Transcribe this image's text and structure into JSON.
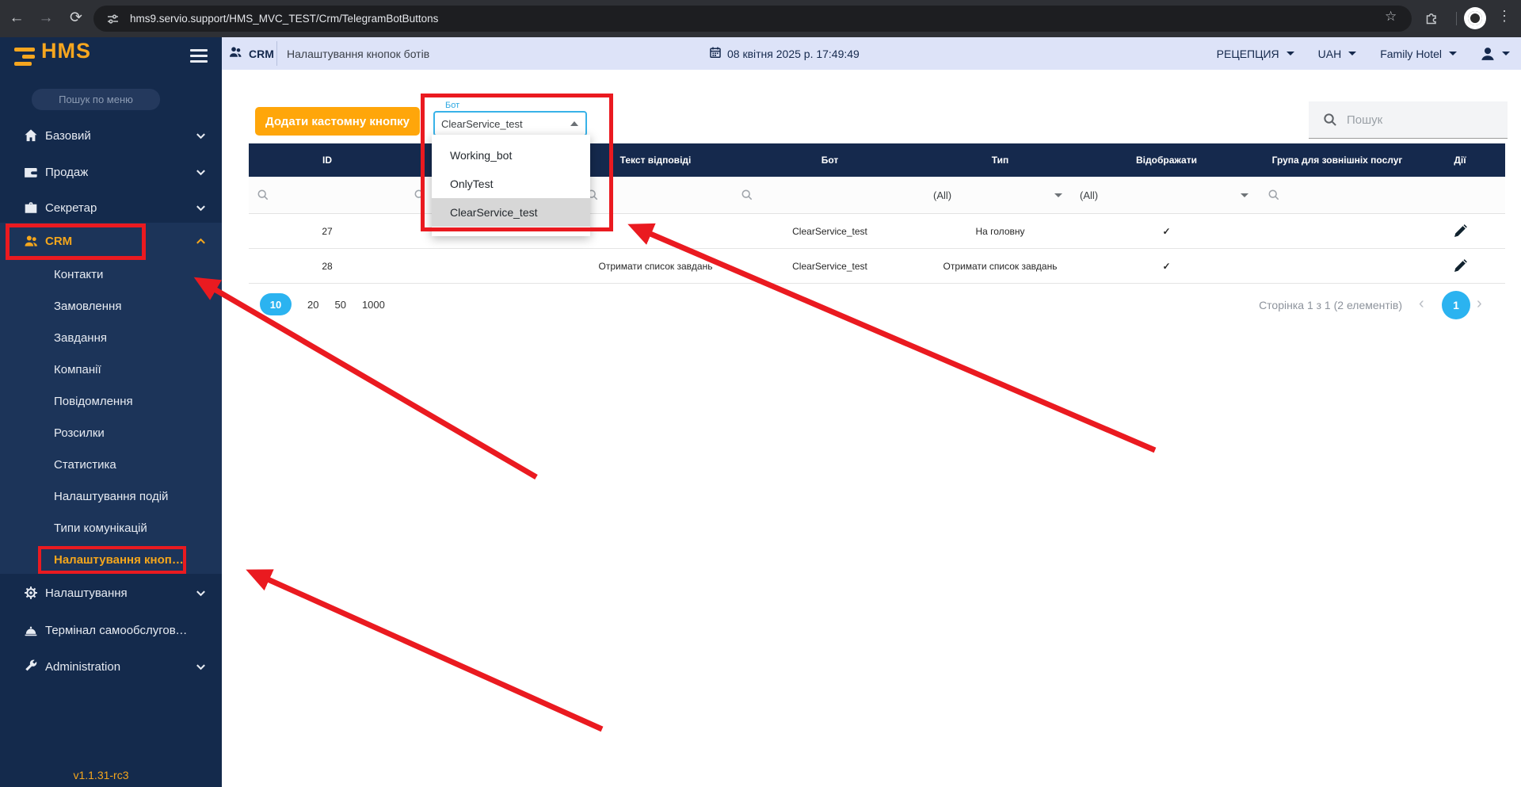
{
  "colors": {
    "accent_orange": "#ffa60a",
    "navy": "#15294d",
    "accent_blue": "#2bb3f0",
    "annotation_red": "#ea1a20"
  },
  "browser": {
    "url": "hms9.servio.support/HMS_MVC_TEST/Crm/TelegramBotButtons"
  },
  "header": {
    "module": "CRM",
    "page_title": "Налаштування кнопок ботів",
    "datetime": "08 квітня 2025 р. 17:49:49",
    "outlet": "РЕЦЕПЦИЯ",
    "currency": "UAH",
    "hotel": "Family Hotel"
  },
  "sidebar": {
    "logo_text": "HMS",
    "search_placeholder": "Пошук по меню",
    "items": [
      "Базовий",
      "Продаж",
      "Секретар",
      "CRM",
      "Налаштування",
      "Термінал самообслуговува...",
      "Administration"
    ],
    "crm_children": [
      "Контакти",
      "Замовлення",
      "Завдання",
      "Компанії",
      "Повідомлення",
      "Розсилки",
      "Статистика",
      "Налаштування подій",
      "Типи комунікацій",
      "Налаштування кнопок бо..."
    ],
    "version": "v1.1.31-rc3"
  },
  "toolbar": {
    "add_button": "Додати кастомну кнопку",
    "search_placeholder": "Пошук"
  },
  "bot_select": {
    "label": "Бот",
    "value": "ClearService_test",
    "options": [
      "Working_bot",
      "OnlyTest",
      "ClearService_test"
    ]
  },
  "table": {
    "columns": [
      "ID",
      "",
      "Текст відповіді",
      "Бот",
      "Тип",
      "Відображати",
      "Група для зовнішніх послуг",
      "Дії"
    ],
    "filter_all": "(All)",
    "rows": [
      {
        "id": "27",
        "button_text": "",
        "response_text": "",
        "bot": "ClearService_test",
        "type": "На головну",
        "display": "✓",
        "external_group": ""
      },
      {
        "id": "28",
        "button_text": "",
        "response_text": "Отримати список завдань",
        "bot": "ClearService_test",
        "type": "Отримати список завдань",
        "display": "✓",
        "external_group": ""
      }
    ]
  },
  "pagination": {
    "sizes": [
      "10",
      "20",
      "50",
      "1000"
    ],
    "active_size": "10",
    "info": "Сторінка 1 з 1 (2 елементів)",
    "current_page": "1",
    "prev_icon": "‹",
    "next_icon": "›"
  }
}
